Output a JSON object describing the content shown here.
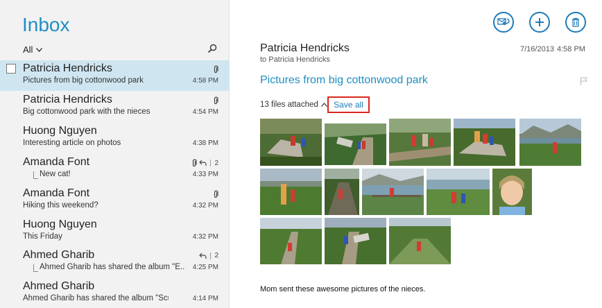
{
  "list": {
    "title": "Inbox",
    "filter_label": "All",
    "messages": [
      {
        "from": "Patricia Hendricks",
        "subject": "Pictures from big cottonwood park",
        "time": "4:58 PM",
        "attachment": true,
        "selected": true
      },
      {
        "from": "Patricia Hendricks",
        "subject": "Big cottonwood park with the nieces",
        "time": "4:54 PM",
        "attachment": true
      },
      {
        "from": "Huong Nguyen",
        "subject": "Interesting article on photos",
        "time": "4:38 PM"
      },
      {
        "from": "Amanda Font",
        "subject": "New cat!",
        "time": "4:33 PM",
        "attachment": true,
        "replied": true,
        "count": "2",
        "thread": true
      },
      {
        "from": "Amanda Font",
        "subject": "Hiking this weekend?",
        "time": "4:32 PM",
        "attachment": true
      },
      {
        "from": "Huong Nguyen",
        "subject": "This Friday",
        "time": "4:32 PM"
      },
      {
        "from": "Ahmed Gharib",
        "subject": "Ahmed Gharib has shared the album \"E...",
        "time": "4:25 PM",
        "replied": true,
        "count": "2",
        "thread": true
      },
      {
        "from": "Ahmed Gharib",
        "subject": "Ahmed Gharib has shared the album \"Scuba ...",
        "time": "4:14 PM"
      }
    ]
  },
  "message": {
    "sender": "Patricia Hendricks",
    "to_line": "to Patricia Hendricks",
    "date": "7/16/2013",
    "time": "4:58 PM",
    "subject": "Pictures from big cottonwood park",
    "attachments_label": "13 files attached",
    "save_all_label": "Save all",
    "body": "Mom sent these awesome pictures of the nieces."
  },
  "icons": {
    "search": "search-icon",
    "filter_chevron": "chevron-down-icon",
    "attachment": "paperclip-icon",
    "reply": "reply-icon",
    "respond": "respond-icon",
    "new": "plus-icon",
    "delete": "trash-icon",
    "flag": "flag-icon",
    "collapse": "chevron-up-icon"
  },
  "colors": {
    "accent": "#1e8fc4",
    "selected_row": "#cfe6f1",
    "list_background": "#f2f2f2",
    "save_all_highlight": "#d9271e",
    "button_ring": "#1e7ab8"
  }
}
